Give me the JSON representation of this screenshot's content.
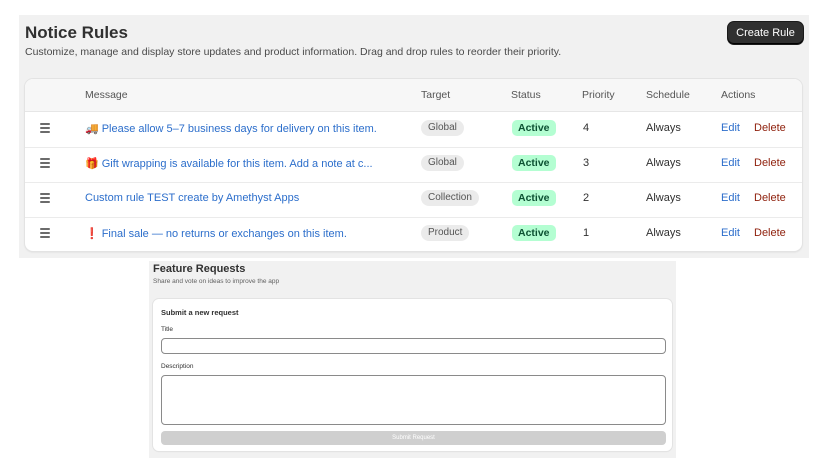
{
  "notice_rules": {
    "title": "Notice Rules",
    "subtitle": "Customize, manage and display store updates and product information. Drag and drop rules to reorder their priority.",
    "create_button": "Create Rule",
    "columns": {
      "message": "Message",
      "target": "Target",
      "status": "Status",
      "priority": "Priority",
      "schedule": "Schedule",
      "actions": "Actions"
    },
    "rows": [
      {
        "icon": "🚚",
        "icon_name": "delivery-truck-icon",
        "message": "Please allow 5–7 business days for delivery on this item.",
        "target": "Global",
        "status": "Active",
        "priority": "4",
        "schedule": "Always",
        "edit": "Edit",
        "delete": "Delete"
      },
      {
        "icon": "🎁",
        "icon_name": "gift-icon",
        "message": "Gift wrapping is available for this item. Add a note at c...",
        "target": "Global",
        "status": "Active",
        "priority": "3",
        "schedule": "Always",
        "edit": "Edit",
        "delete": "Delete"
      },
      {
        "icon": "",
        "icon_name": "",
        "message": "Custom rule TEST create by Amethyst Apps",
        "target": "Collection",
        "status": "Active",
        "priority": "2",
        "schedule": "Always",
        "edit": "Edit",
        "delete": "Delete"
      },
      {
        "icon": "❗",
        "icon_name": "exclamation-icon",
        "message": "Final sale — no returns or exchanges on this item.",
        "target": "Product",
        "status": "Active",
        "priority": "1",
        "schedule": "Always",
        "edit": "Edit",
        "delete": "Delete"
      }
    ],
    "colors": {
      "link": "#2c6ecb",
      "delete": "#8e1f0b",
      "status_bg": "#b4fed2",
      "status_text": "#0c5132",
      "button_bg": "#303030"
    }
  },
  "feature_requests": {
    "title": "Feature Requests",
    "subtitle": "Share and vote on ideas to improve the app",
    "form_heading": "Submit a new request",
    "title_label": "Title",
    "title_value": "",
    "description_label": "Description",
    "description_value": "",
    "submit_button": "Submit Request",
    "submit_disabled": true
  }
}
